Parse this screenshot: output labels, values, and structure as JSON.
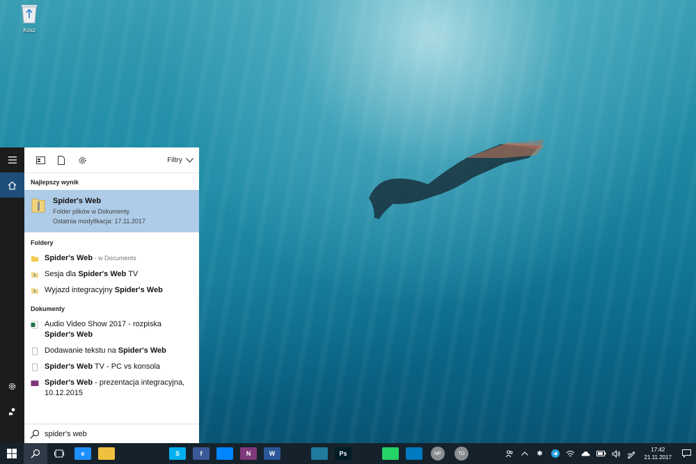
{
  "desktop": {
    "recycle_bin_label": "Kosz"
  },
  "search_panel": {
    "filters_label": "Filtry",
    "best_match": {
      "section_title": "Najlepszy wynik",
      "title": "Spider's Web",
      "subtitle": "Folder plików w Dokumenty",
      "modified": "Ostatnia modyfikacja: 17.11.2017"
    },
    "folders": {
      "section_title": "Foldery",
      "items": [
        {
          "pre": "",
          "bold": "Spider's Web",
          "post": "",
          "note": " - w Documents"
        },
        {
          "pre": "Sesja dla ",
          "bold": "Spider's Web",
          "post": " TV",
          "note": ""
        },
        {
          "pre": "Wyjazd integracyjny ",
          "bold": "Spider's Web",
          "post": "",
          "note": ""
        }
      ]
    },
    "documents": {
      "section_title": "Dokumenty",
      "items": [
        {
          "pre": "Audio Video Show 2017 - rozpiska ",
          "bold": "Spider's Web",
          "post": "",
          "icon": "excel-file-icon"
        },
        {
          "pre": "Dodawanie tekstu na ",
          "bold": "Spider's Web",
          "post": "",
          "icon": "text-file-icon"
        },
        {
          "pre": "",
          "bold": "Spider's Web",
          "post": " TV - PC vs konsola",
          "icon": "text-file-icon"
        },
        {
          "pre": "",
          "bold": "Spider's Web",
          "post": " - prezentacja integracyjna, 10.12.2015",
          "icon": "onenote-file-icon"
        }
      ]
    },
    "search_query": "spider's web"
  },
  "taskbar": {
    "apps": [
      {
        "name": "edge",
        "label": "e",
        "color": "#1e90ff"
      },
      {
        "name": "explorer",
        "label": "",
        "color": "#f0c040"
      },
      {
        "name": "onedrive",
        "label": "",
        "color": "transparent"
      },
      {
        "name": "mail",
        "label": "",
        "color": "transparent"
      },
      {
        "name": "skype",
        "label": "S",
        "color": "#00aff0"
      },
      {
        "name": "facebook",
        "label": "f",
        "color": "#3b5998"
      },
      {
        "name": "messenger",
        "label": "",
        "color": "#0084ff"
      },
      {
        "name": "onenote",
        "label": "N",
        "color": "#80397b"
      },
      {
        "name": "word",
        "label": "W",
        "color": "#2b579a"
      },
      {
        "name": "app-octopus",
        "label": "",
        "color": "transparent"
      },
      {
        "name": "calculator",
        "label": "",
        "color": "#1f7a9e"
      },
      {
        "name": "photoshop",
        "label": "Ps",
        "color": "#001d26"
      },
      {
        "name": "slack",
        "label": "",
        "color": "transparent"
      },
      {
        "name": "whatsapp",
        "label": "",
        "color": "#25d366"
      },
      {
        "name": "trello",
        "label": "",
        "color": "#0079bf"
      }
    ],
    "avatars": [
      "NP",
      "TD"
    ],
    "clock": {
      "time": "17:42",
      "date": "21.11.2017"
    }
  }
}
